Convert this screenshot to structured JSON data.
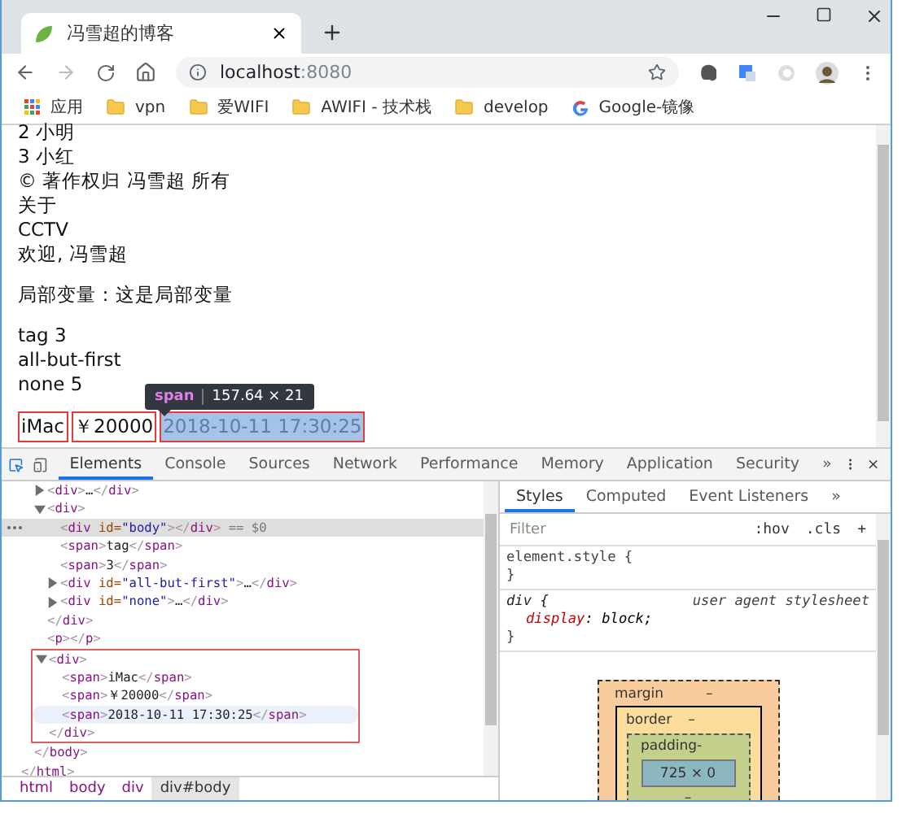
{
  "browser": {
    "tab": {
      "title": "冯雪超的博客"
    },
    "address": {
      "host": "localhost",
      "port": ":8080"
    },
    "bookmarks": [
      {
        "kind": "apps",
        "label": "应用"
      },
      {
        "kind": "folder",
        "label": "vpn"
      },
      {
        "kind": "folder",
        "label": "爱WIFI"
      },
      {
        "kind": "folder",
        "label": "AWIFI - 技术栈"
      },
      {
        "kind": "folder",
        "label": "develop"
      },
      {
        "kind": "google",
        "label": "Google-镜像"
      }
    ]
  },
  "page": {
    "paragraphs": [
      [
        "2 小明",
        "3 小红",
        "© 著作权归 冯雪超 所有",
        "关于",
        "CCTV",
        "欢迎, 冯雪超"
      ],
      [
        "局部变量：这是局部变量"
      ],
      [
        "tag 3",
        "all-but-first",
        "none 5"
      ]
    ],
    "spans": [
      {
        "text": "iMac",
        "outlined": true,
        "highlighted": false
      },
      {
        "text": "￥20000",
        "outlined": true,
        "highlighted": false
      },
      {
        "text": "2018-10-11 17:30:25",
        "outlined": true,
        "highlighted": true
      }
    ],
    "tooltip": {
      "tag": "span",
      "size": "157.64 × 21"
    }
  },
  "devtools": {
    "tabs": [
      {
        "label": "Elements",
        "selected": true
      },
      {
        "label": "Console",
        "selected": false
      },
      {
        "label": "Sources",
        "selected": false
      },
      {
        "label": "Network",
        "selected": false
      },
      {
        "label": "Performance",
        "selected": false
      },
      {
        "label": "Memory",
        "selected": false
      },
      {
        "label": "Application",
        "selected": false
      },
      {
        "label": "Security",
        "selected": false
      }
    ],
    "more": "»",
    "dom": [
      {
        "close": "</html>",
        "expanded": true,
        "children": [
          {
            "close": "</body>",
            "expanded": true,
            "children": [
              {
                "open": "<div>…</div>",
                "expanded": false
              },
              {
                "open": "<div>",
                "close": "</div>",
                "expanded": true,
                "children": [
                  {
                    "open": "<div id=\"body\"></div>",
                    "selected": true,
                    "suffix": "== $0"
                  },
                  {
                    "open": "<span>tag</span>"
                  },
                  {
                    "open": "<span>3</span>"
                  },
                  {
                    "open": "<div id=\"all-but-first\">…</div>",
                    "expanded": false
                  },
                  {
                    "open": "<div id=\"none\">…</div>",
                    "expanded": false
                  }
                ]
              },
              {
                "open": "<p></p>"
              },
              {
                "open": "<div>",
                "close": "</div>",
                "expanded": true,
                "outlined": true,
                "children": [
                  {
                    "open": "<span>iMac</span>"
                  },
                  {
                    "open": "<span>￥20000</span>"
                  },
                  {
                    "open": "<span>2018-10-11 17:30:25</span>",
                    "hovered": true
                  }
                ]
              }
            ]
          }
        ]
      }
    ],
    "breadcrumbs": [
      {
        "label": "html",
        "selected": false
      },
      {
        "label": "body",
        "selected": false
      },
      {
        "label": "div",
        "selected": false
      },
      {
        "label": "div#body",
        "selected": true
      }
    ],
    "styles_tabs": [
      {
        "label": "Styles",
        "selected": true
      },
      {
        "label": "Computed",
        "selected": false
      },
      {
        "label": "Event Listeners",
        "selected": false
      }
    ],
    "styles_more": "»",
    "filter": {
      "placeholder": "Filter"
    },
    "filter_buttons": [
      ":hov",
      ".cls",
      "+"
    ],
    "rules": [
      {
        "selector": "element.style {",
        "close": "}"
      },
      {
        "selector": "div {",
        "source": "user agent stylesheet",
        "close": "}",
        "declarations": [
          {
            "property": "display",
            "separator": ":",
            "value": "block;"
          }
        ]
      }
    ],
    "box_model": {
      "margin_label": "margin",
      "margin": "–",
      "border_label": "border",
      "border": "–",
      "padding_label": "padding",
      "padding": "-",
      "content": "725 × 0",
      "padding_bottom": "–"
    }
  }
}
